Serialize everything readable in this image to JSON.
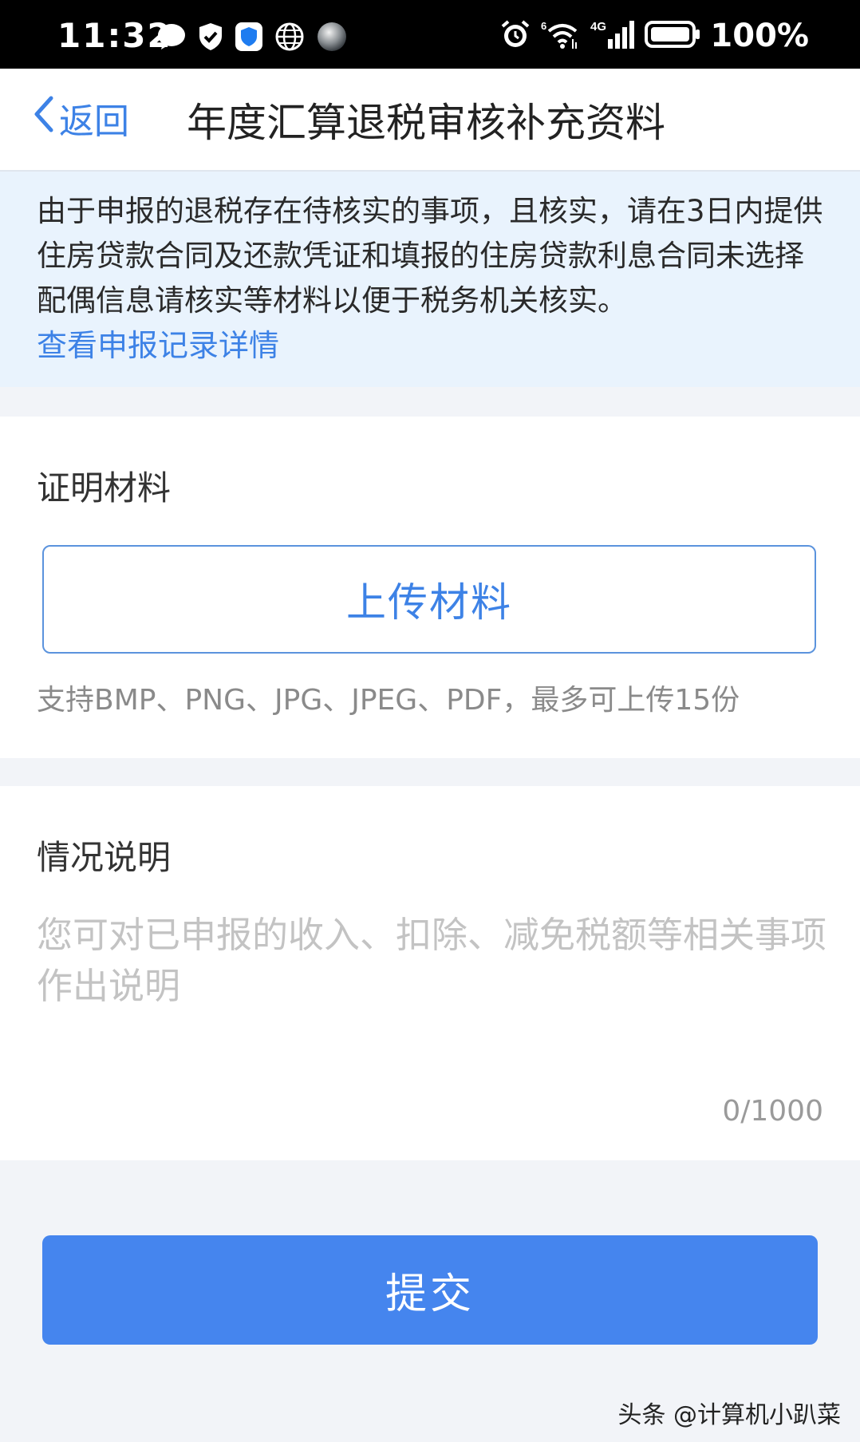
{
  "status_bar": {
    "time": "11:32",
    "battery": "100%",
    "network": "4G",
    "icons_left": [
      "chat-bubble-icon",
      "shield-check-icon",
      "blue-shield-icon",
      "globe-icon",
      "sphere-icon"
    ],
    "icons_right": [
      "alarm-icon",
      "wifi-icon",
      "signal-icon",
      "battery-icon"
    ]
  },
  "nav": {
    "back_label": "返回",
    "title": "年度汇算退税审核补充资料"
  },
  "notice": {
    "text": "由于申报的退税存在待核实的事项，且核实，请在3日内提供住房贷款合同及还款凭证和填报的住房贷款利息合同未选择配偶信息请核实等材料以便于税务机关核实。",
    "link_label": "查看申报记录详情"
  },
  "materials": {
    "label": "证明材料",
    "upload_label": "上传材料",
    "hint": "支持BMP、PNG、JPG、JPEG、PDF，最多可上传15份"
  },
  "description": {
    "label": "情况说明",
    "placeholder": "您可对已申报的收入、扣除、减免税额等相关事项作出说明",
    "value": "",
    "char_count": "0/1000"
  },
  "submit_label": "提交",
  "watermark": "头条 @计算机小趴菜",
  "colors": {
    "accent": "#3d82e6",
    "submit_bg": "#4585ee",
    "notice_bg": "#e9f3fd",
    "page_bg": "#f2f4f8"
  }
}
